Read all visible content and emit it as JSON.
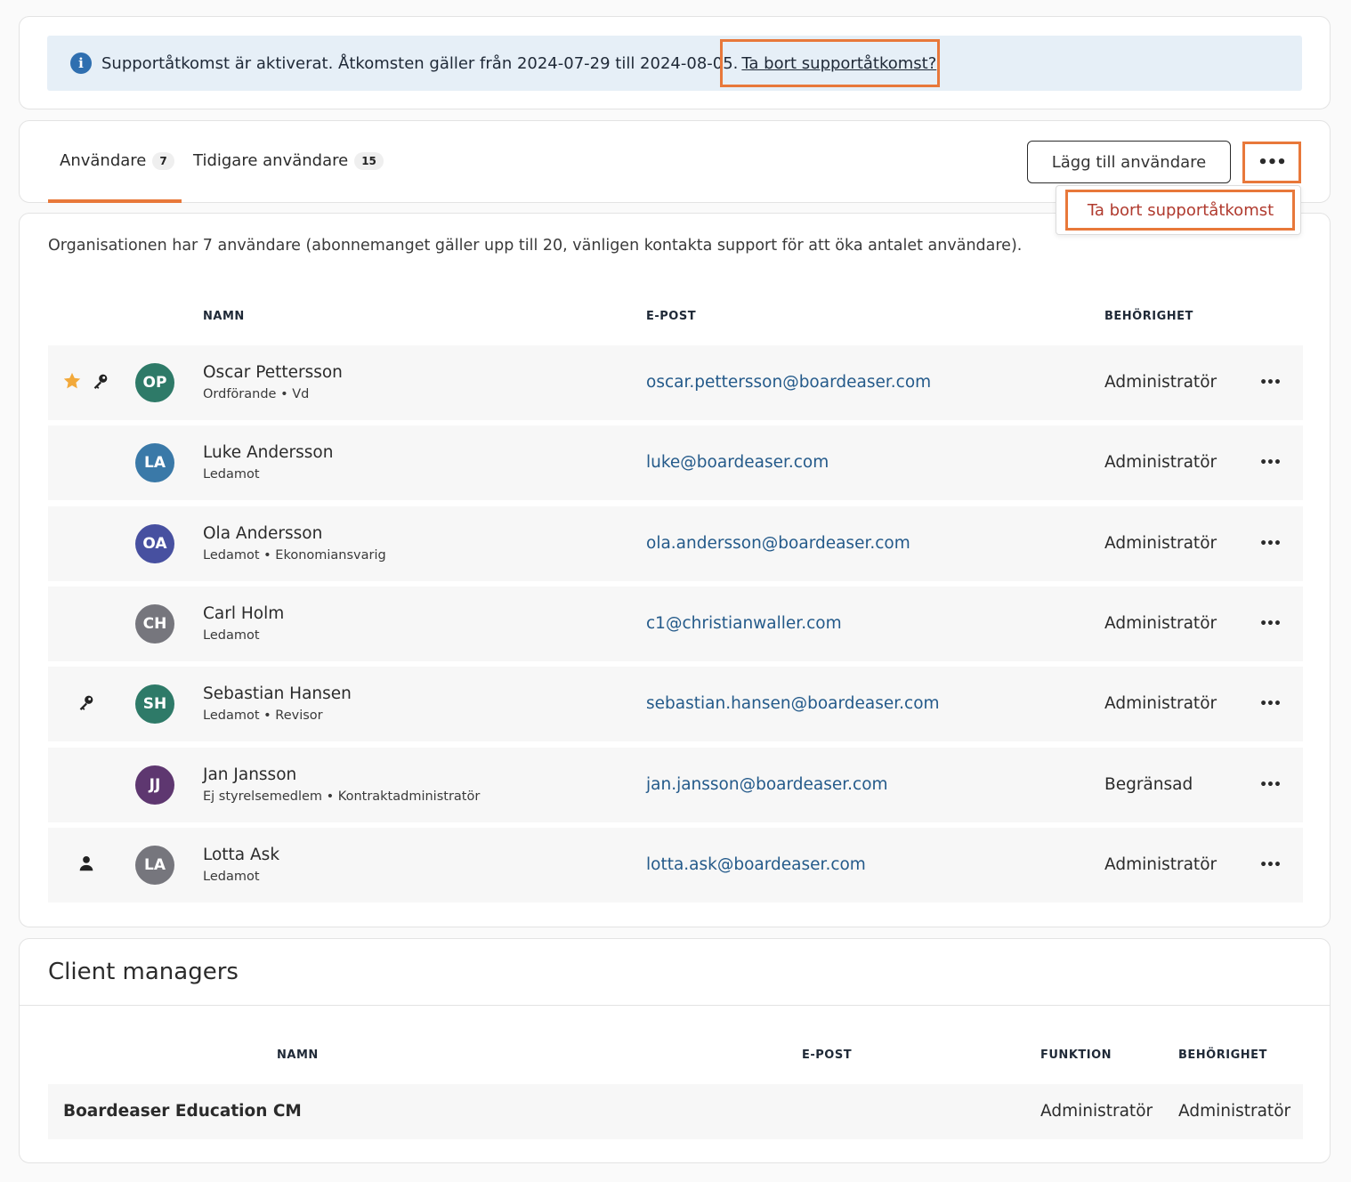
{
  "banner": {
    "message": "Supportåtkomst är aktiverat. Åtkomsten gäller från 2024-07-29 till 2024-08-05.",
    "link": "Ta bort supportåtkomst?",
    "icon": "info-icon"
  },
  "tabs": [
    {
      "label": "Användare",
      "count": "7",
      "active": true
    },
    {
      "label": "Tidigare användare",
      "count": "15",
      "active": false
    }
  ],
  "toolbar": {
    "add_label": "Lägg till användare",
    "more_label": "•••"
  },
  "dropdown": {
    "item": "Ta bort supportåtkomst"
  },
  "users": {
    "info": "Organisationen har 7 användare (abonnemanget gäller upp till 20, vänligen kontakta support för att öka antalet användare).",
    "headers": {
      "name": "NAMN",
      "email": "E-POST",
      "permission": "BEHÖRIGHET"
    },
    "rows": [
      {
        "initials": "OP",
        "color": "#2e7a68",
        "name": "Oscar Pettersson",
        "role": "Ordförande • Vd",
        "email": "oscar.pettersson@boardeaser.com",
        "permission": "Administratör",
        "icons": [
          "star-icon",
          "key-icon"
        ]
      },
      {
        "initials": "LA",
        "color": "#3a79a8",
        "name": "Luke Andersson",
        "role": "Ledamot",
        "email": "luke@boardeaser.com",
        "permission": "Administratör",
        "icons": []
      },
      {
        "initials": "OA",
        "color": "#4750a0",
        "name": "Ola Andersson",
        "role": "Ledamot • Ekonomiansvarig",
        "email": "ola.andersson@boardeaser.com",
        "permission": "Administratör",
        "icons": []
      },
      {
        "initials": "CH",
        "color": "#76767d",
        "name": "Carl Holm",
        "role": "Ledamot",
        "email": "c1@christianwaller.com",
        "permission": "Administratör",
        "icons": []
      },
      {
        "initials": "SH",
        "color": "#2e7a68",
        "name": "Sebastian Hansen",
        "role": "Ledamot • Revisor",
        "email": "sebastian.hansen@boardeaser.com",
        "permission": "Administratör",
        "icons": [
          "key-icon"
        ]
      },
      {
        "initials": "JJ",
        "color": "#5e3770",
        "name": "Jan Jansson",
        "role": "Ej styrelsemedlem • Kontraktadministratör",
        "email": "jan.jansson@boardeaser.com",
        "permission": "Begränsad",
        "icons": []
      },
      {
        "initials": "LA",
        "color": "#76767d",
        "name": "Lotta Ask",
        "role": "Ledamot",
        "email": "lotta.ask@boardeaser.com",
        "permission": "Administratör",
        "icons": [
          "person-icon"
        ]
      }
    ],
    "row_more": "•••"
  },
  "client_managers": {
    "title": "Client managers",
    "headers": {
      "name": "NAMN",
      "email": "E-POST",
      "function": "FUNKTION",
      "permission": "BEHÖRIGHET"
    },
    "rows": [
      {
        "name": "Boardeaser Education CM",
        "email": "",
        "function": "Administratör",
        "permission": "Administratör"
      }
    ]
  },
  "colors": {
    "accent": "#e8783a",
    "link": "#245a8a",
    "danger": "#b03a2e",
    "banner_bg": "#e6eff7"
  }
}
